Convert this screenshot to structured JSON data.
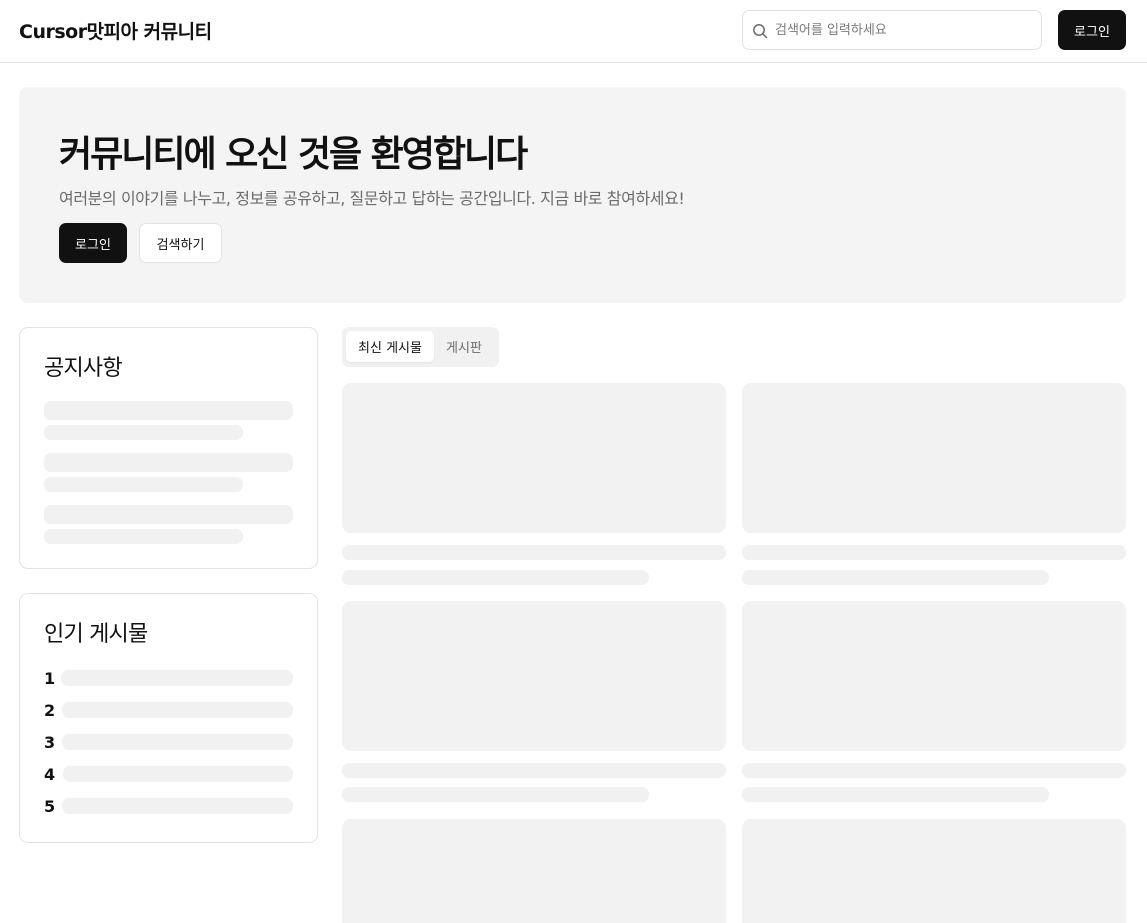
{
  "header": {
    "brand": "Cursor맛피아 커뮤니티",
    "search_placeholder": "검색어를 입력하세요",
    "login_label": "로그인"
  },
  "hero": {
    "title": "커뮤니티에 오신 것을 환영합니다",
    "subtitle": "여러분의 이야기를 나누고, 정보를 공유하고, 질문하고 답하는 공간입니다. 지금 바로 참여하세요!",
    "login_label": "로그인",
    "search_label": "검색하기"
  },
  "notice": {
    "title": "공지사항"
  },
  "popular": {
    "title": "인기 게시물",
    "ranks": [
      "1",
      "2",
      "3",
      "4",
      "5"
    ]
  },
  "tabs": {
    "latest": "최신 게시물",
    "boards": "게시판"
  },
  "icons": {
    "search": "search-icon"
  }
}
